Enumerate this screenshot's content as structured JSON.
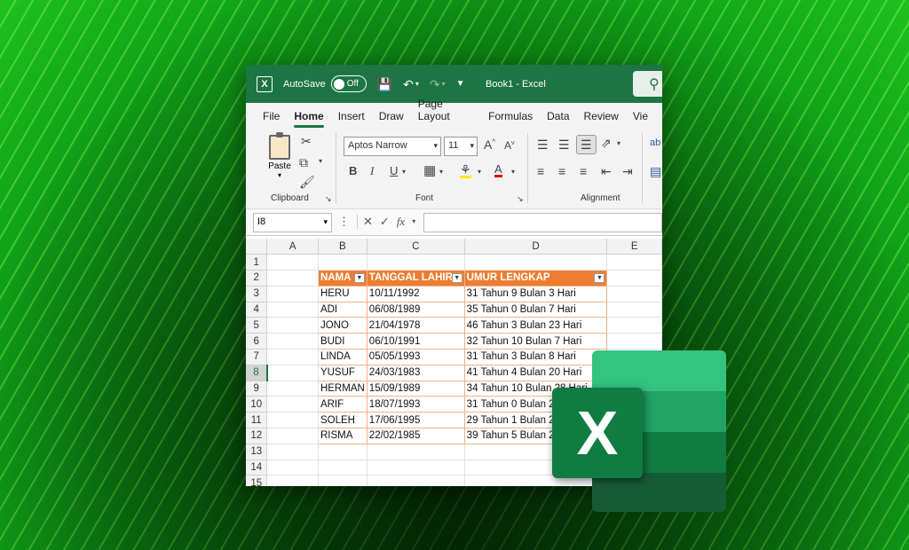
{
  "titlebar": {
    "autosave_label": "AutoSave",
    "toggle_state": "Off",
    "doc_title": "Book1  -  Excel"
  },
  "tabs": [
    "File",
    "Home",
    "Insert",
    "Draw",
    "Page Layout",
    "Formulas",
    "Data",
    "Review",
    "Vie"
  ],
  "ribbon": {
    "paste_label": "Paste",
    "clipboard_label": "Clipboard",
    "font_name": "Aptos Narrow",
    "font_size": "11",
    "font_label": "Font",
    "alignment_label": "Alignment",
    "bold": "B",
    "italic": "I",
    "underline": "U",
    "grow_font": "A",
    "shrink_font": "A",
    "font_color": "A"
  },
  "formula_bar": {
    "name_box": "I8",
    "fx": "fx",
    "content": ""
  },
  "sheet": {
    "columns": [
      "A",
      "B",
      "C",
      "D",
      "E"
    ],
    "selected_row": 8,
    "table_headers": [
      "NAMA",
      "TANGGAL LAHIR",
      "UMUR LENGKAP"
    ],
    "rows": [
      [
        "HERU",
        "10/11/1992",
        "31 Tahun 9 Bulan 3 Hari"
      ],
      [
        "ADI",
        "06/08/1989",
        "35 Tahun 0 Bulan 7 Hari"
      ],
      [
        "JONO",
        "21/04/1978",
        "46 Tahun 3 Bulan 23 Hari"
      ],
      [
        "BUDI",
        "06/10/1991",
        "32 Tahun 10 Bulan 7 Hari"
      ],
      [
        "LINDA",
        "05/05/1993",
        "31 Tahun 3 Bulan 8 Hari"
      ],
      [
        "YUSUF",
        "24/03/1983",
        "41 Tahun 4 Bulan 20 Hari"
      ],
      [
        "HERMAN",
        "15/09/1989",
        "34 Tahun 10 Bulan 28 Hari"
      ],
      [
        "ARIF",
        "18/07/1993",
        "31 Tahun 0 Bulan 26 Hari"
      ],
      [
        "SOLEH",
        "17/06/1995",
        "29 Tahun 1 Bulan 27 Hari"
      ],
      [
        "RISMA",
        "22/02/1985",
        "39 Tahun 5 Bulan 22 Hari"
      ]
    ]
  },
  "logo": {
    "letter": "X"
  },
  "colors": {
    "excel_green": "#1c7543",
    "table_header": "#ed7d31",
    "table_border": "#f4b184"
  }
}
